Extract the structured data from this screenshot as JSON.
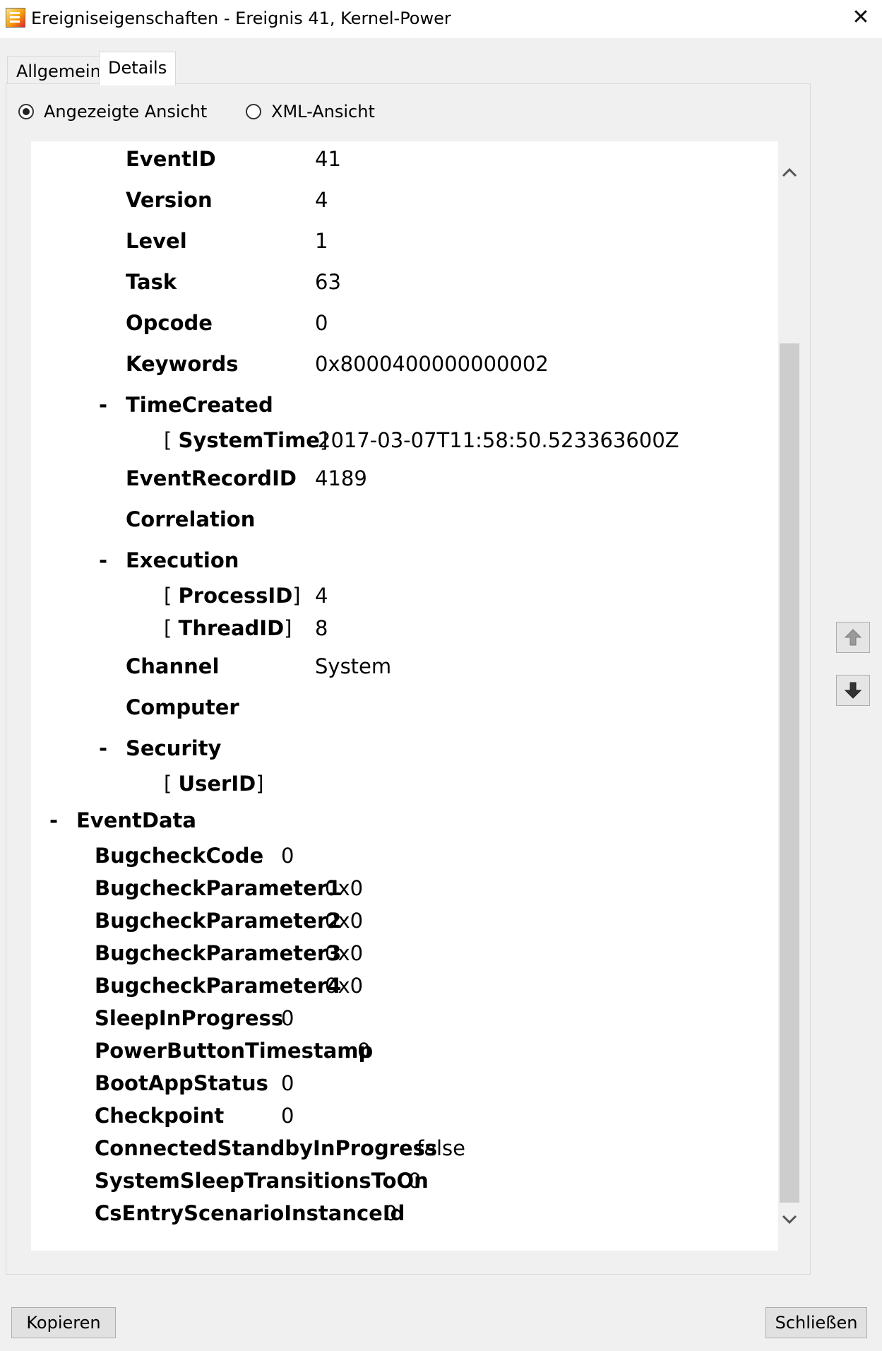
{
  "window": {
    "title": "Ereigniseigenschaften - Ereignis 41, Kernel-Power",
    "close_glyph": "✕"
  },
  "tabs": [
    {
      "label": "Allgemein",
      "active": false
    },
    {
      "label": "Details",
      "active": true
    }
  ],
  "view_options": [
    {
      "label": "Angezeigte Ansicht",
      "checked": true
    },
    {
      "label": "XML-Ansicht",
      "checked": false
    }
  ],
  "system_rows": [
    {
      "key": "EventID",
      "value": "41"
    },
    {
      "key": "Version",
      "value": "4"
    },
    {
      "key": "Level",
      "value": "1"
    },
    {
      "key": "Task",
      "value": "63"
    },
    {
      "key": "Opcode",
      "value": "0"
    },
    {
      "key": "Keywords",
      "value": "0x8000400000000002"
    }
  ],
  "time_created": {
    "toggle": "-",
    "label": "TimeCreated",
    "attr_key": "SystemTime",
    "attr_value": "2017-03-07T11:58:50.523363600Z"
  },
  "event_record": {
    "key": "EventRecordID",
    "value": "4189"
  },
  "correlation": {
    "key": "Correlation"
  },
  "execution": {
    "toggle": "-",
    "label": "Execution",
    "attrs": [
      {
        "key": "ProcessID",
        "value": "4"
      },
      {
        "key": "ThreadID",
        "value": "8"
      }
    ]
  },
  "channel": {
    "key": "Channel",
    "value": "System"
  },
  "computer": {
    "key": "Computer"
  },
  "security": {
    "toggle": "-",
    "label": "Security",
    "attr_key": "UserID"
  },
  "event_data": {
    "toggle": "-",
    "label": "EventData",
    "rows": [
      {
        "key": "BugcheckCode",
        "value": "0"
      },
      {
        "key": "BugcheckParameter1",
        "value": "0x0"
      },
      {
        "key": "BugcheckParameter2",
        "value": "0x0"
      },
      {
        "key": "BugcheckParameter3",
        "value": "0x0"
      },
      {
        "key": "BugcheckParameter4",
        "value": "0x0"
      },
      {
        "key": "SleepInProgress",
        "value": "0"
      },
      {
        "key": "PowerButtonTimestamp",
        "value": "0"
      },
      {
        "key": "BootAppStatus",
        "value": "0"
      },
      {
        "key": "Checkpoint",
        "value": "0"
      },
      {
        "key": "ConnectedStandbyInProgress",
        "value": "false"
      },
      {
        "key": "SystemSleepTransitionsToOn",
        "value": "0"
      },
      {
        "key": "CsEntryScenarioInstanceId",
        "value": "0"
      }
    ]
  },
  "buttons": {
    "copy": "Kopieren",
    "close": "Schließen"
  },
  "icons": {
    "scroll_up": "chevron-up-icon",
    "scroll_down": "chevron-down-icon",
    "prev_event": "arrow-up-icon",
    "next_event": "arrow-down-icon"
  }
}
